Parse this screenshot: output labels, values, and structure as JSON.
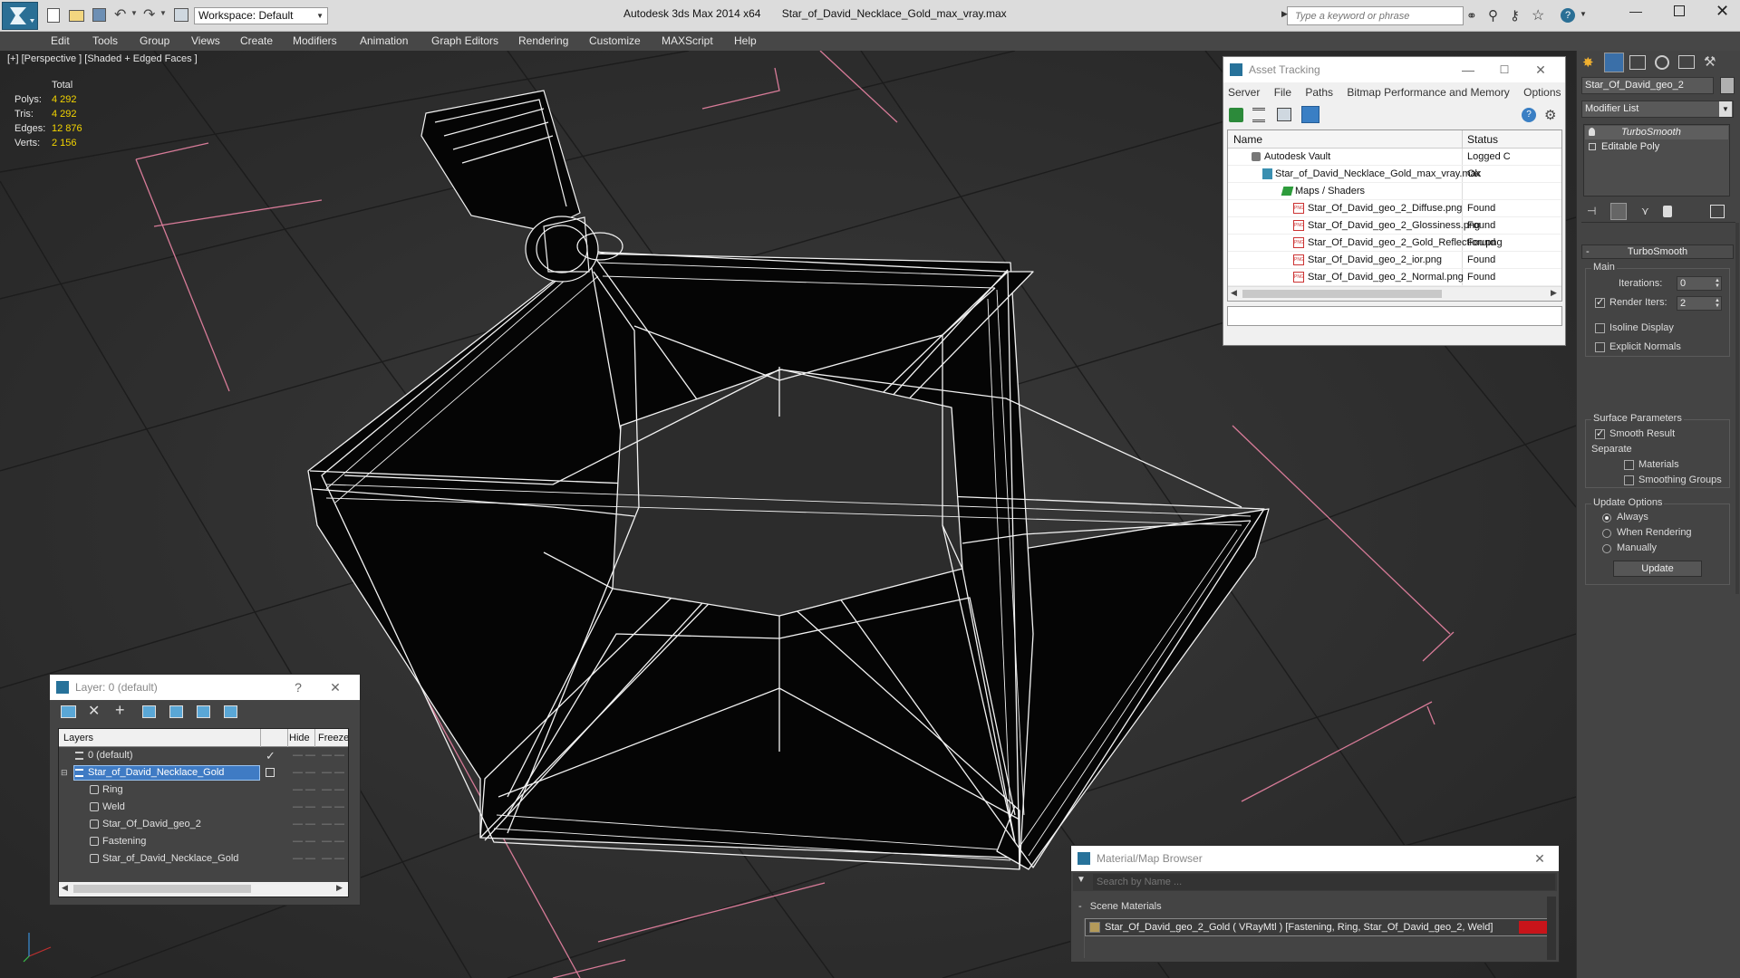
{
  "app": {
    "title": "Autodesk 3ds Max  2014 x64",
    "file": "Star_of_David_Necklace_Gold_max_vray.max",
    "workspace": "Workspace: Default",
    "search_placeholder": "Type a keyword or phrase"
  },
  "menu": [
    "Edit",
    "Tools",
    "Group",
    "Views",
    "Create",
    "Modifiers",
    "Animation",
    "Graph Editors",
    "Rendering",
    "Customize",
    "MAXScript",
    "Help"
  ],
  "viewport": {
    "label": "[+] [Perspective ] [Shaded + Edged Faces ]",
    "stats": {
      "header": "Total",
      "polys_label": "Polys:",
      "polys": "4 292",
      "tris_label": "Tris:",
      "tris": "4 292",
      "edges_label": "Edges:",
      "edges": "12 876",
      "verts_label": "Verts:",
      "verts": "2 156"
    }
  },
  "asset_tracking": {
    "title": "Asset Tracking",
    "menu": [
      "Server",
      "File",
      "Paths",
      "Bitmap Performance and Memory",
      "Options"
    ],
    "col_name": "Name",
    "col_status": "Status",
    "rows": [
      {
        "name": "Autodesk Vault",
        "status": "Logged C"
      },
      {
        "name": "Star_of_David_Necklace_Gold_max_vray.max",
        "status": "Ok"
      },
      {
        "name": "Maps / Shaders",
        "status": ""
      },
      {
        "name": "Star_Of_David_geo_2_Diffuse.png",
        "status": "Found"
      },
      {
        "name": "Star_Of_David_geo_2_Glossiness.png",
        "status": "Found"
      },
      {
        "name": "Star_Of_David_geo_2_Gold_Reflection.png",
        "status": "Found"
      },
      {
        "name": "Star_Of_David_geo_2_ior.png",
        "status": "Found"
      },
      {
        "name": "Star_Of_David_geo_2_Normal.png",
        "status": "Found"
      }
    ]
  },
  "layer": {
    "title": "Layer: 0 (default)",
    "help": "?",
    "col_layers": "Layers",
    "col_hide": "Hide",
    "col_freeze": "Freeze",
    "rows": [
      {
        "name": "0 (default)"
      },
      {
        "name": "Star_of_David_Necklace_Gold"
      },
      {
        "name": "Ring"
      },
      {
        "name": "Weld"
      },
      {
        "name": "Star_Of_David_geo_2"
      },
      {
        "name": "Fastening"
      },
      {
        "name": "Star_of_David_Necklace_Gold"
      }
    ]
  },
  "material_browser": {
    "title": "Material/Map Browser",
    "search_placeholder": "Search by Name ...",
    "section": "Scene Materials",
    "item": "Star_Of_David_geo_2_Gold  ( VRayMtl ) [Fastening, Ring, Star_Of_David_geo_2, Weld]"
  },
  "command_panel": {
    "object_name": "Star_Of_David_geo_2",
    "modifier_list": "Modifier List",
    "stack": [
      "TurboSmooth",
      "Editable Poly"
    ],
    "rollout_title": "TurboSmooth",
    "main_group": "Main",
    "iterations_label": "Iterations:",
    "iterations": "0",
    "render_iters_label": "Render Iters:",
    "render_iters": "2",
    "isoline": "Isoline Display",
    "explicit_normals": "Explicit Normals",
    "surface_params": "Surface Parameters",
    "smooth_result": "Smooth Result",
    "separate": "Separate",
    "materials": "Materials",
    "smoothing_groups": "Smoothing Groups",
    "update_options": "Update Options",
    "always": "Always",
    "when_rendering": "When Rendering",
    "manually": "Manually",
    "update_btn": "Update"
  }
}
